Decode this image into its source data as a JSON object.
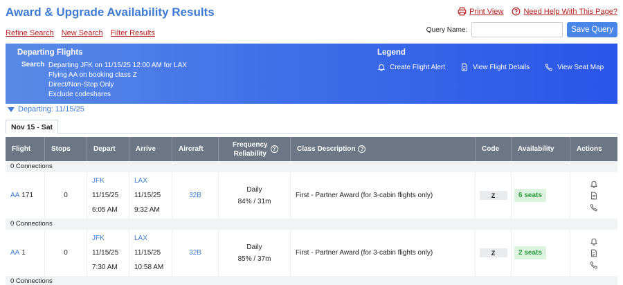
{
  "header": {
    "title": "Award & Upgrade Availability Results",
    "print_label": "Print View",
    "help_label": "Need Help With This Page?"
  },
  "actions": {
    "refine": "Refine Search",
    "new": "New Search",
    "filter": "Filter Results"
  },
  "query": {
    "label": "Query Name:",
    "value": "",
    "placeholder": "",
    "save_label": "Save Query"
  },
  "banner": {
    "title": "Departing Flights",
    "search_label": "Search",
    "search_lines": [
      "Departing JFK on 11/15/25 12:00 AM for LAX",
      "Flying AA on booking class Z",
      "Direct/Non-Stop Only",
      "Exclude codeshares"
    ],
    "legend_title": "Legend",
    "legend": [
      {
        "icon": "bell-icon",
        "label": "Create Flight Alert"
      },
      {
        "icon": "document-icon",
        "label": "View Flight Details"
      },
      {
        "icon": "phone-icon",
        "label": "View Seat Map"
      }
    ]
  },
  "departing_toggle": "Departing: 11/15/25",
  "date_tab": "Nov 15 - Sat",
  "columns": {
    "flight": "Flight",
    "stops": "Stops",
    "depart": "Depart",
    "arrive": "Arrive",
    "aircraft": "Aircraft",
    "frequency_line1": "Frequency",
    "frequency_line2": "Reliability",
    "class": "Class Description",
    "code": "Code",
    "availability": "Availability",
    "actions": "Actions"
  },
  "connections_label": "0 Connections",
  "flights": [
    {
      "airline": "AA",
      "number": "171",
      "stops": "0",
      "depart_airport": "JFK",
      "depart_date": "11/15/25",
      "depart_time": "6:05 AM",
      "arrive_airport": "LAX",
      "arrive_date": "11/15/25",
      "arrive_time": "9:32 AM",
      "aircraft": "32B",
      "frequency": "Daily",
      "reliability": "84% / 31m",
      "class_description": "First - Partner Award (for 3-cabin flights only)",
      "code": "Z",
      "availability": "6 seats"
    },
    {
      "airline": "AA",
      "number": "1",
      "stops": "0",
      "depart_airport": "JFK",
      "depart_date": "11/15/25",
      "depart_time": "7:30 AM",
      "arrive_airport": "LAX",
      "arrive_date": "11/15/25",
      "arrive_time": "10:58 AM",
      "aircraft": "32B",
      "frequency": "Daily",
      "reliability": "85% / 37m",
      "class_description": "First - Partner Award (for 3-cabin flights only)",
      "code": "Z",
      "availability": "2 seats"
    }
  ],
  "colors": {
    "title_blue": "#3e7bd8",
    "link_red": "#b81d1d",
    "banner_start": "#5a8ae6",
    "banner_end": "#2a55e8",
    "header_gray": "#6d7684",
    "seats_green": "#2f9a41"
  }
}
